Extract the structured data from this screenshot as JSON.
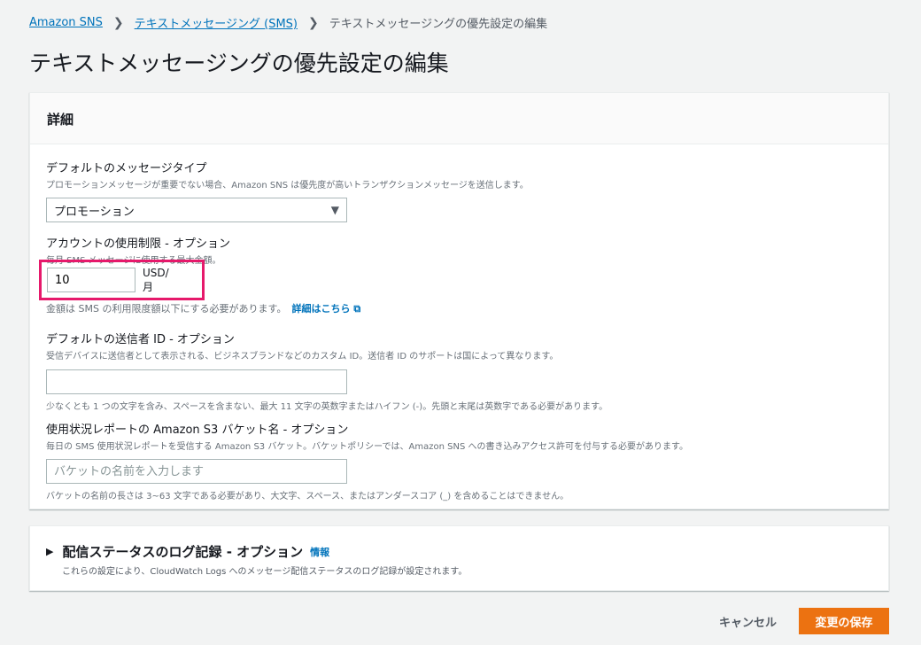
{
  "breadcrumb": {
    "root": "Amazon SNS",
    "parent": "テキストメッセージング (SMS)",
    "current": "テキストメッセージングの優先設定の編集"
  },
  "page_title": "テキストメッセージングの優先設定の編集",
  "details": {
    "header": "詳細",
    "message_type": {
      "label": "デフォルトのメッセージタイプ",
      "description": "プロモーションメッセージが重要でない場合、Amazon SNS は優先度が高いトランザクションメッセージを送信します。",
      "selected": "プロモーション"
    },
    "spend_limit": {
      "label": "アカウントの使用制限 - オプション",
      "description": "毎月 SMS メッセージに使用する最大金額。",
      "value": "10",
      "unit": "USD/ 月",
      "hint": "金額は SMS の利用限度額以下にする必要があります。",
      "link": "詳細はこちら"
    },
    "sender_id": {
      "label": "デフォルトの送信者 ID - オプション",
      "description": "受信デバイスに送信者として表示される、ビジネスブランドなどのカスタム ID。送信者 ID のサポートは国によって異なります。",
      "value": "",
      "hint": "少なくとも 1 つの文字を含み、スペースを含まない、最大 11 文字の英数字またはハイフン (-)。先頭と末尾は英数字である必要があります。"
    },
    "s3_bucket": {
      "label": "使用状況レポートの Amazon S3 バケット名 - オプション",
      "description": "毎日の SMS 使用状況レポートを受信する Amazon S3 バケット。バケットポリシーでは、Amazon SNS への書き込みアクセス許可を付与する必要があります。",
      "placeholder": "バケットの名前を入力します",
      "hint": "バケットの名前の長さは 3~63 文字である必要があり、大文字、スペース、またはアンダースコア (_) を含めることはできません。"
    }
  },
  "delivery_log": {
    "title": "配信ステータスのログ記録 - オプション",
    "info": "情報",
    "description": "これらの設定により、CloudWatch Logs へのメッセージ配信ステータスのログ記録が設定されます。"
  },
  "actions": {
    "cancel": "キャンセル",
    "save": "変更の保存"
  }
}
